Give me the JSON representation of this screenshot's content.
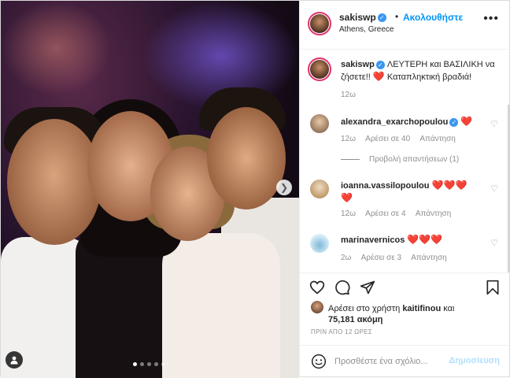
{
  "post": {
    "photo_alt": "",
    "carousel_dots": 5,
    "active_dot": 0
  },
  "header": {
    "username": "sakiswp",
    "follow_label": "Ακολουθήστε",
    "separator": "•",
    "location": "Athens, Greece",
    "more_label": "•••"
  },
  "caption": {
    "username": "sakiswp",
    "text": "ΛΕΥΤΕΡΗ και ΒΑΣΙΛΙΚΗ να ζήσετε!!",
    "text2": "Καταπληκτική βραδιά!",
    "time": "12ω"
  },
  "comments": [
    {
      "username": "alexandra_exarchopoulou",
      "verified": true,
      "hearts": 1,
      "time": "12ω",
      "likes": "Αρέσει σε 40",
      "reply": "Απάντηση",
      "view_replies": "Προβολή απαντήσεων (1)"
    },
    {
      "username": "ioanna.vassilopoulou",
      "hearts": 4,
      "time": "12ω",
      "likes": "Αρέσει σε 4",
      "reply": "Απάντηση"
    },
    {
      "username": "marinavernicos",
      "hearts": 3,
      "time": "2ω",
      "likes": "Αρέσει σε 3",
      "reply": "Απάντηση"
    }
  ],
  "likes": {
    "prefix": "Αρέσει στο χρήστη",
    "user": "kaitifinou",
    "and": "και",
    "count": "75,181 ακόμη"
  },
  "time_ago": "ΠΡΙΝ ΑΠΟ 12 ΩΡΕΣ",
  "add_comment": {
    "placeholder": "Προσθέστε ένα σχόλιο...",
    "post_label": "Δημοσίευση"
  },
  "colors": {
    "link_blue": "#0095f6",
    "heart_red": "#ed4956",
    "muted": "#8e8e8e",
    "post_disabled": "#b2dffc"
  },
  "heart_glyph": "❤️"
}
